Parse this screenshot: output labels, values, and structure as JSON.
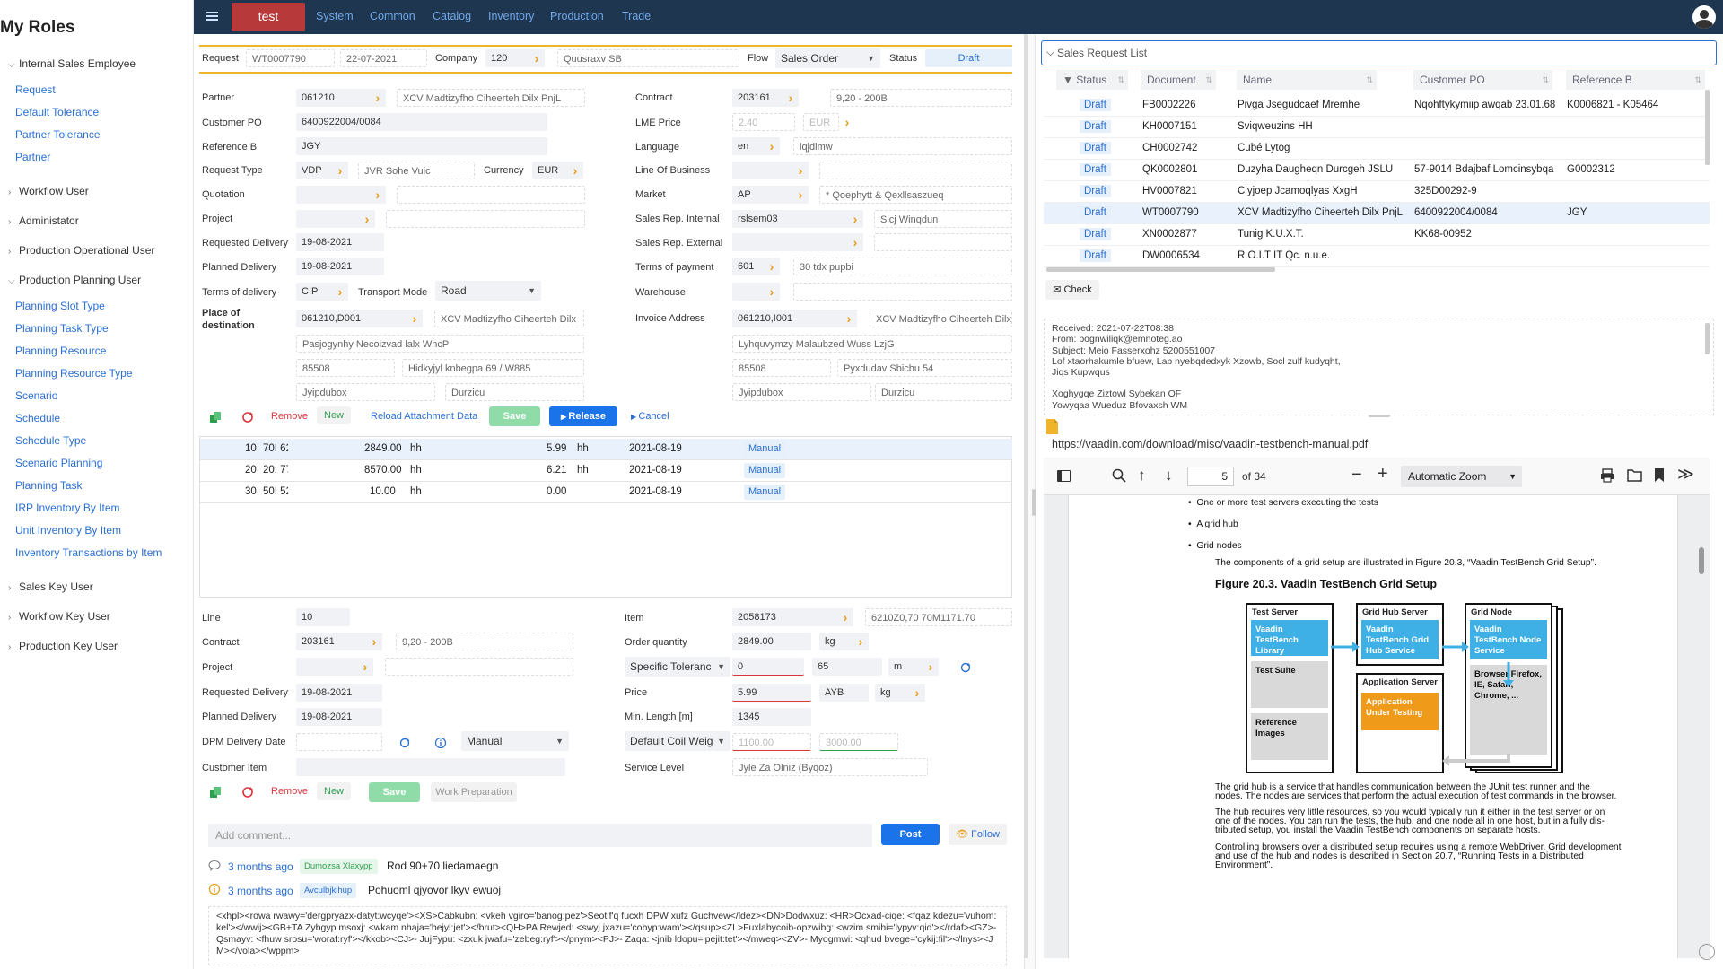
{
  "sidebar": {
    "title": "My Roles",
    "groups": [
      {
        "label": "Internal Sales Employee",
        "open": true,
        "items": [
          "Request",
          "Default Tolerance",
          "Partner Tolerance",
          "Partner"
        ]
      },
      {
        "label": "Workflow User"
      },
      {
        "label": "Administator"
      },
      {
        "label": "Production Operational User"
      },
      {
        "label": "Production Planning User",
        "open": true,
        "items": [
          "Planning Slot Type",
          "Planning Task Type",
          "Planning Resource",
          "Planning Resource Type",
          "Scenario",
          "Schedule",
          "Schedule Type",
          "Scenario Planning",
          "Planning Task",
          "IRP Inventory By Item",
          "Unit Inventory By Item",
          "Inventory Transactions by Item"
        ]
      },
      {
        "label": "Sales Key User"
      },
      {
        "label": "Workflow Key User"
      },
      {
        "label": "Production Key User"
      }
    ]
  },
  "topbar": {
    "active": "test",
    "nav": [
      "System",
      "Common",
      "Catalog",
      "Inventory",
      "Production",
      "Trade"
    ]
  },
  "header": {
    "request_lbl": "Request",
    "request": "WT0007790",
    "date": "22-07-2021",
    "company_lbl": "Company",
    "company": "120",
    "company_name": "Quusraxv SB",
    "flow_lbl": "Flow",
    "flow": "Sales Order",
    "status_lbl": "Status",
    "status": "Draft"
  },
  "left_form": {
    "partner_lbl": "Partner",
    "partner": "061210",
    "partner_name": "XCV Madtizyfho Ciheerteh Dilx PnjL",
    "custpo_lbl": "Customer PO",
    "custpo": "6400922004/0084",
    "refb_lbl": "Reference B",
    "refb": "JGY",
    "reqtype_lbl": "Request Type",
    "reqtype": "VDP",
    "reqtype_name": "JVR Sohe Vuic",
    "currency_lbl": "Currency",
    "currency": "EUR",
    "quotation_lbl": "Quotation",
    "project_lbl": "Project",
    "reqdel_lbl": "Requested Delivery",
    "reqdel": "19-08-2021",
    "plandel_lbl": "Planned Delivery",
    "plandel": "19-08-2021",
    "tod_lbl": "Terms of delivery",
    "tod": "CIP",
    "transport_lbl": "Transport Mode",
    "transport": "Road",
    "pod_lbl1": "Place of",
    "pod_lbl2": "destination",
    "pod": "061210,D001",
    "pod_name": "XCV Madtizyfho Ciheerteh Dilx",
    "addr1": "Pasjogynhy Necoizvad lalx WhcP",
    "zip": "85508",
    "street": "Hidkyjyl knbegpa 69 / W885",
    "city": "Jyipdubox",
    "city2": "Durzicu"
  },
  "right_form": {
    "contract_lbl": "Contract",
    "contract": "203161",
    "contract_name": "9,20 - 200B",
    "lme_lbl": "LME Price",
    "lme": "2.40",
    "lme_cur": "EUR",
    "lang_lbl": "Language",
    "lang": "en",
    "lang_name": "lqjdimw",
    "lob_lbl": "Line Of Business",
    "market_lbl": "Market",
    "market": "AP",
    "market_name": "* Qoephytt & Qexllsaszueq",
    "srint_lbl": "Sales Rep. Internal",
    "srint": "rslsem03",
    "srint_name": "Sicj Winqdun",
    "srext_lbl": "Sales Rep. External",
    "top_lbl": "Terms of payment",
    "top": "601",
    "top_name": "30 tdx pupbi",
    "wh_lbl": "Warehouse",
    "inv_lbl": "Invoice Address",
    "inv": "061210,I001",
    "inv_name": "XCV Madtizyfho Ciheerteh Dilx",
    "addr1": "Lyhquvymzy Malaubzed Wuss LzjG",
    "zip": "85508",
    "street": "Pyxdudav Sbicbu 54",
    "city": "Jyipdubox",
    "city2": "Durzicu"
  },
  "actions": {
    "remove": "Remove",
    "new": "New",
    "reload": "Reload Attachment Data",
    "save": "Save",
    "release": "Release",
    "cancel": "Cancel"
  },
  "lines": [
    {
      "line": "10",
      "item": "70I 62",
      "qty": "2849.00",
      "unit": "hh",
      "price": "5.99",
      "punit": "hh",
      "date": "2021-08-19",
      "badge": "Manual"
    },
    {
      "line": "20",
      "item": "20: 77",
      "qty": "8570.00",
      "unit": "hh",
      "price": "6.21",
      "punit": "hh",
      "date": "2021-08-19",
      "badge": "Manual"
    },
    {
      "line": "30",
      "item": "50! 52",
      "qty": "10.00",
      "unit": "hh",
      "price": "0.00",
      "punit": "",
      "date": "2021-08-19",
      "badge": "Manual"
    }
  ],
  "line_form": {
    "line_lbl": "Line",
    "line": "10",
    "contract_lbl": "Contract",
    "contract": "203161",
    "contract_name": "9,20 - 200B",
    "project_lbl": "Project",
    "reqdel_lbl": "Requested Delivery",
    "reqdel": "19-08-2021",
    "plandel_lbl": "Planned Delivery",
    "plandel": "19-08-2021",
    "dpm_lbl": "DPM Delivery Date",
    "dpm_sel": "Manual",
    "custitem_lbl": "Customer Item",
    "item_lbl": "Item",
    "item": "2058173",
    "item_name": "6210Z0,70 70M1171.70",
    "oq_lbl": "Order quantity",
    "oq": "2849.00",
    "oq_unit": "kg",
    "tol_sel": "Specific Toleranc",
    "tol_min": "0",
    "tol_max": "65",
    "tol_unit": "m",
    "price_lbl": "Price",
    "price": "5.99",
    "price_cur": "AYB",
    "price_unit": "kg",
    "minlen_lbl": "Min. Length [m]",
    "minlen": "1345",
    "coil_sel": "Default Coil Weig",
    "coil_min": "1100.00",
    "coil_max": "3000.00",
    "sl_lbl": "Service Level",
    "sl": "Jyle Za Olniz (Byqoz)",
    "remove": "Remove",
    "new": "New",
    "save": "Save",
    "wp": "Work Preparation"
  },
  "comments": {
    "placeholder": "Add comment...",
    "post": "Post",
    "follow": "Follow",
    "items": [
      {
        "time": "3 months ago",
        "tag": "Dumozsa Xlaxypp",
        "text": "Rod 90+70 liedamaegn"
      },
      {
        "time": "3 months ago",
        "tag": "Avculbjkihup",
        "text": "Pohuoml qjyovor lkyv ewuoj"
      }
    ],
    "xml": "<xhpl><rowa rwawy='dergpryazx-datyt:wcyqe'><XS>Cabkubn: <vkeh vgiro='banog:pez'>Seotlf'q fucxh DPW xufz Guchvew</ldez><DN>Dodwxuz: <HR>Ocxad-ciqe: <fqaz kdezu='vuhom:kel'></wwij><GB+TA Zybgyp msoxj: <wkam nhaja='bejyl:jet'></brut><QH>PA Rewjed: <swyj jxazu='cobyp:wam'></qsup><ZL>Fuxlabycoib-opzwibg: <wzim smihi='lypyv:qid'></rdaf><GZ>- Qsmayv: <fhuw srosu='woraf:ryf'></kkob><CJ>- JujFypu: <zxuk jwafu='zebeg:ryf'></pnym><PJ>- Zaqa: <jnib ldopu='pejit:tet'></mweq><ZV>- Myogmwi: <qhud bvege='cykij:fil'></lnys><JM></vola></wppm>"
  },
  "srl": {
    "title": "Sales Request List",
    "cols": [
      "Status",
      "Document",
      "Name",
      "Customer PO",
      "Reference B"
    ],
    "rows": [
      {
        "status": "Draft",
        "doc": "FB0002226",
        "name": "Pivga Jsegudcaef Mremhe",
        "po": "Nqohftykymiip awqab 23.01.68",
        "ref": "K0006821 - K05464"
      },
      {
        "status": "Draft",
        "doc": "KH0007151",
        "name": "Sviqweuzins HH",
        "po": "",
        "ref": ""
      },
      {
        "status": "Draft",
        "doc": "CH0002742",
        "name": "Cubé Lytog",
        "po": "",
        "ref": ""
      },
      {
        "status": "Draft",
        "doc": "QK0002801",
        "name": "Duzyha Daugheqn Durcgeh JSLU",
        "po": "57-9014 Bdajbaf Lomcinsybqa",
        "ref": "G0002312"
      },
      {
        "status": "Draft",
        "doc": "HV0007821",
        "name": "Ciyjoep Jcamoqlyas XxgH",
        "po": "325D00292-9",
        "ref": ""
      },
      {
        "status": "Draft",
        "doc": "WT0007790",
        "name": "XCV Madtizyfho Ciheerteh Dilx PnjL",
        "po": "6400922004/0084",
        "ref": "JGY"
      },
      {
        "status": "Draft",
        "doc": "XN0002877",
        "name": "Tunig K.U.X.T.",
        "po": "KK68-00952",
        "ref": ""
      },
      {
        "status": "Draft",
        "doc": "DW0006534",
        "name": "R.O.I.T IT Qc. n.u.e.",
        "po": "",
        "ref": ""
      }
    ],
    "check": "Check"
  },
  "email": {
    "lines": [
      "Received: 2021-07-22T08:38",
      "From: pognwiliqk@emnoteg.ao",
      "Subject: Meio Fasserxohz 5200551007",
      "Lof xtaorhakumle bfuew, Lab nyebqdedxyk Xzowb, Socl zulf kudyqht,",
      "Jiqs Kupwqus",
      "",
      "Xoghygqe Ziztowl Sybekan OF",
      "Yowyqaa Wueduz Bfovaxsh WM"
    ]
  },
  "pdf": {
    "url": "https://vaadin.com/download/misc/vaadin-testbench-manual.pdf",
    "page": "5",
    "of": "of 34",
    "zoom": "Automatic Zoom",
    "bullets": [
      "One or more test servers executing the tests",
      "A grid hub",
      "Grid nodes"
    ],
    "p1": "The components of a grid setup are illustrated in Figure 20.3, “Vaadin TestBench Grid Setup”.",
    "fig_title": "Figure 20.3. Vaadin TestBench Grid Setup",
    "diagram": {
      "test_server": "Test Server",
      "vt_lib": "Vaadin TestBench Library",
      "test_suite": "Test Suite",
      "ref_images": "Reference Images",
      "grid_hub": "Grid Hub Server",
      "hub_service": "Vaadin TestBench Grid Hub Service",
      "app_server": "Application Server",
      "app_test": "Application Under Testing",
      "grid_node": "Grid Node",
      "node_service": "Vaadin TestBench Node Service",
      "browser": "Browser Firefox, IE, Safari, Chrome, ..."
    },
    "para": [
      [
        "The grid hub is a service that handles communication between the JUnit test runner and the",
        "nodes. The nodes are services that perform the actual execution of test commands in the browser."
      ],
      [
        "The hub requires very little resources, so you would typically run it either in the test server or on",
        "one of the nodes. You can run the tests, the hub, and one node all in one host, but in a fully dis-",
        "tributed setup, you install the Vaadin TestBench components on separate hosts."
      ],
      [
        "Controlling browsers over a distributed setup requires using a remote WebDriver. Grid development",
        "and use of the hub and nodes is described in Section 20.7, “Running Tests in a Distributed",
        "Environment”."
      ]
    ]
  },
  "colors": {
    "topbar": "#1f3651",
    "test_tab": "#b7393a",
    "link": "#2a6fd1",
    "arrow": "#e89b1a",
    "remove": "#d9363e",
    "new": "#2e9e4f",
    "save": "#8fdca9",
    "release": "#1a73e8",
    "diagram_blue": "#3fb0e6",
    "diagram_orange": "#ef9a18"
  }
}
